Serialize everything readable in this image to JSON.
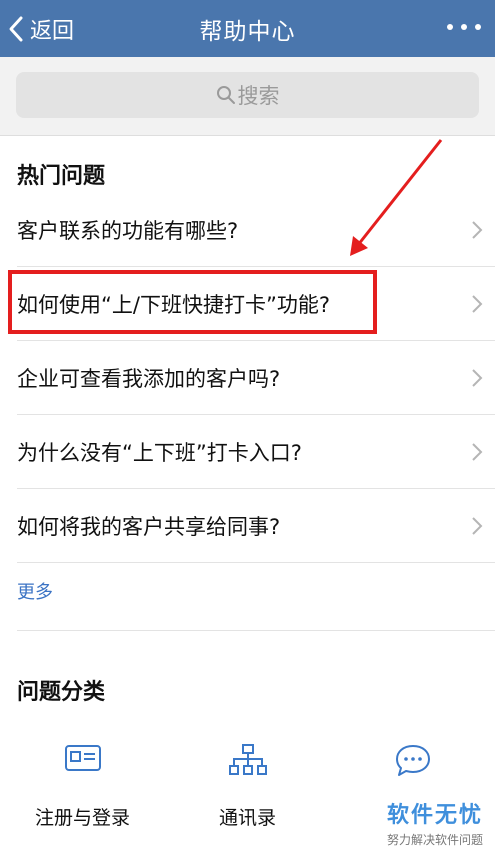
{
  "header": {
    "back_label": "返回",
    "title": "帮助中心"
  },
  "search": {
    "placeholder": "搜索"
  },
  "hot": {
    "title": "热门问题",
    "questions": [
      "客户联系的功能有哪些?",
      "如何使用“上/下班快捷打卡”功能?",
      "企业可查看我添加的客户吗?",
      "为什么没有“上下班”打卡入口?",
      "如何将我的客户共享给同事?"
    ],
    "more": "更多"
  },
  "categories": {
    "title": "问题分类",
    "items": [
      {
        "label": "注册与登录",
        "icon": "id-card-icon"
      },
      {
        "label": "通讯录",
        "icon": "org-chart-icon"
      },
      {
        "label": "",
        "icon": "chat-bubble-icon"
      }
    ]
  },
  "watermark": {
    "main": "软件无忧",
    "sub": "努力解决软件问题"
  },
  "colors": {
    "header_bg": "#4a76ad",
    "highlight_border": "#e41e1e",
    "link": "#3b73c4",
    "icon_blue": "#3a78c8"
  }
}
